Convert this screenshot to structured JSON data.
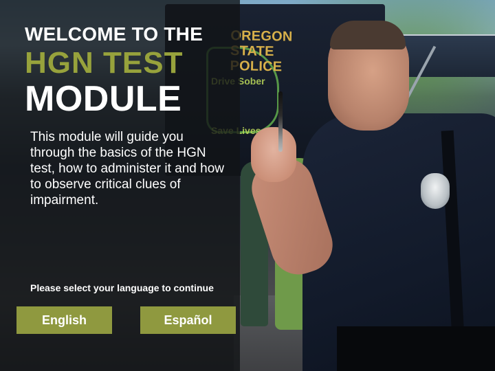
{
  "background": {
    "vehicle_text": "OREGON STATE POLICE",
    "vehicle_slogan_line1": "Drive Sober",
    "vehicle_slogan_line2": "Save Lives"
  },
  "welcome": {
    "title_line1": "WELCOME TO THE",
    "title_line2": "HGN TEST",
    "title_line3": "MODULE",
    "description": "This module will guide you through the basics of the HGN test, how to administer it and how to observe critical clues of impairment.",
    "language_prompt": "Please select your language to continue"
  },
  "language_buttons": {
    "english_label": "English",
    "spanish_label": "Español"
  },
  "colors": {
    "accent": "#97a23c",
    "button": "#8f993f",
    "panel_overlay": "#121416"
  }
}
